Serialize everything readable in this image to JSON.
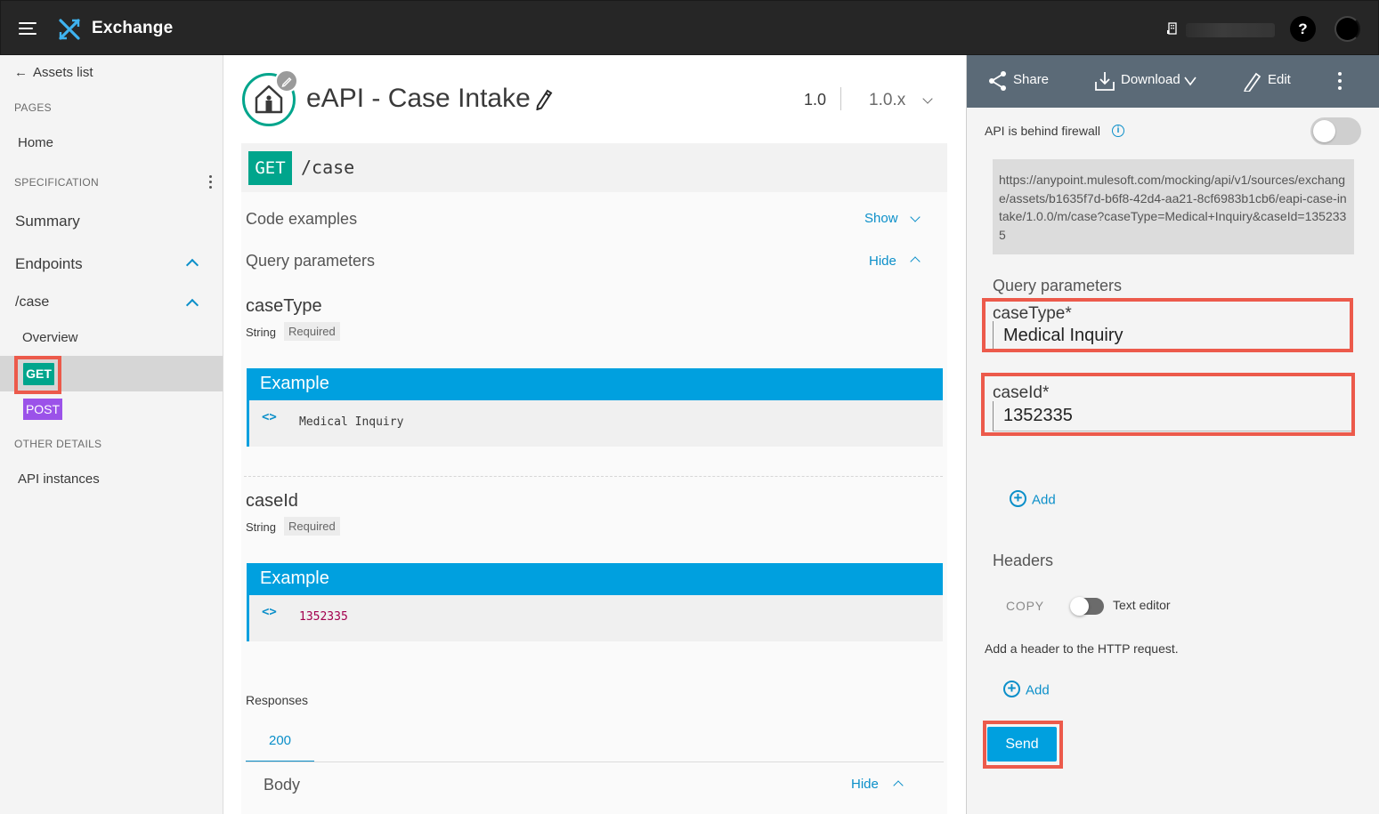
{
  "topbar": {
    "app_title": "Exchange",
    "icons": [
      "menu-icon",
      "exchange-logo-icon",
      "organization-icon",
      "help-icon",
      "avatar"
    ],
    "help_label": "?"
  },
  "sidebar": {
    "back_label": "Assets list",
    "pages_heading": "PAGES",
    "home_label": "Home",
    "spec_heading": "SPECIFICATION",
    "summary_label": "Summary",
    "endpoints_label": "Endpoints",
    "case_label": "/case",
    "overview_label": "Overview",
    "get_label": "GET",
    "post_label": "POST",
    "other_heading": "OTHER DETAILS",
    "instances_label": "API instances"
  },
  "main": {
    "asset_title": "eAPI - Case Intake",
    "version": "1.0",
    "version_select": "1.0.x",
    "method": "GET",
    "path": "/case",
    "code_examples_label": "Code examples",
    "show_label": "Show",
    "query_params_label": "Query parameters",
    "hide_label": "Hide",
    "params": [
      {
        "name": "caseType",
        "type": "String",
        "required": "Required",
        "example_title": "Example",
        "example_value": "Medical Inquiry"
      },
      {
        "name": "caseId",
        "type": "String",
        "required": "Required",
        "example_title": "Example",
        "example_value": "1352335"
      }
    ],
    "responses_label": "Responses",
    "response_code": "200",
    "body_label": "Body",
    "body_hide_label": "Hide"
  },
  "right": {
    "share_label": "Share",
    "download_label": "Download",
    "edit_label": "Edit",
    "firewall_label": "API is behind firewall",
    "firewall_on": false,
    "mock_url": "https://anypoint.mulesoft.com/mocking/api/v1/sources/exchange/assets/b1635f7d-b6f8-42d4-aa21-8cf6983b1cb6/eapi-case-intake/1.0.0/m/case?caseType=Medical+Inquiry&caseId=1352335",
    "query_params_label": "Query parameters",
    "case_type_label": "caseType*",
    "case_type_value": "Medical Inquiry",
    "case_id_label": "caseId*",
    "case_id_value": "1352335",
    "add_label": "Add",
    "headers_label": "Headers",
    "copy_label": "COPY",
    "text_editor_label": "Text editor",
    "header_desc": "Add a header to the HTTP request.",
    "add_header_label": "Add",
    "send_label": "Send"
  },
  "colors": {
    "topbar": "#262626",
    "get_badge": "#00a58c",
    "post_badge": "#9b52e9",
    "accent_blue": "#0b8fc9",
    "example_header": "#00a0df",
    "toolbar": "#5b6a77",
    "highlight_red": "#ec5a4b"
  }
}
